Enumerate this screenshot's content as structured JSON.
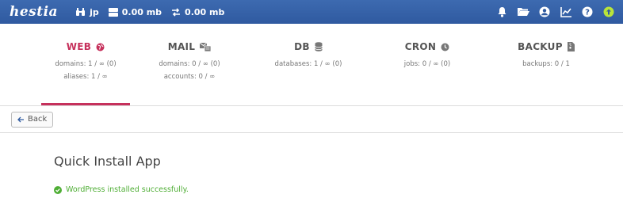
{
  "header": {
    "logo": "hestia",
    "user": "jp",
    "disk": "0.00 mb",
    "bandwidth": "0.00 mb",
    "colors": {
      "bar": "#2f5aa0",
      "update": "#b9e43a"
    },
    "icons": [
      "notifications-bell-icon",
      "folder-icon",
      "user-account-icon",
      "statistics-chart-icon",
      "help-icon",
      "update-arrow-icon"
    ]
  },
  "tabs": [
    {
      "label": "WEB",
      "icon": "globe-icon",
      "lines": [
        "domains: 1 / ∞ (0)",
        "aliases: 1 / ∞"
      ],
      "active": true
    },
    {
      "label": "MAIL",
      "icon": "mail-icon",
      "lines": [
        "domains: 0 / ∞ (0)",
        "accounts: 0 / ∞"
      ]
    },
    {
      "label": "DB",
      "icon": "database-icon",
      "lines": [
        "databases: 1 / ∞ (0)"
      ]
    },
    {
      "label": "CRON",
      "icon": "clock-icon",
      "lines": [
        "jobs: 0 / ∞ (0)"
      ]
    },
    {
      "label": "BACKUP",
      "icon": "file-archive-icon",
      "lines": [
        "backups: 0 / 1"
      ]
    }
  ],
  "toolbar": {
    "back_label": "Back"
  },
  "main": {
    "title": "Quick Install App",
    "message": "WordPress installed successfully.",
    "accent": "#c6315c",
    "success": "#4fae35"
  }
}
